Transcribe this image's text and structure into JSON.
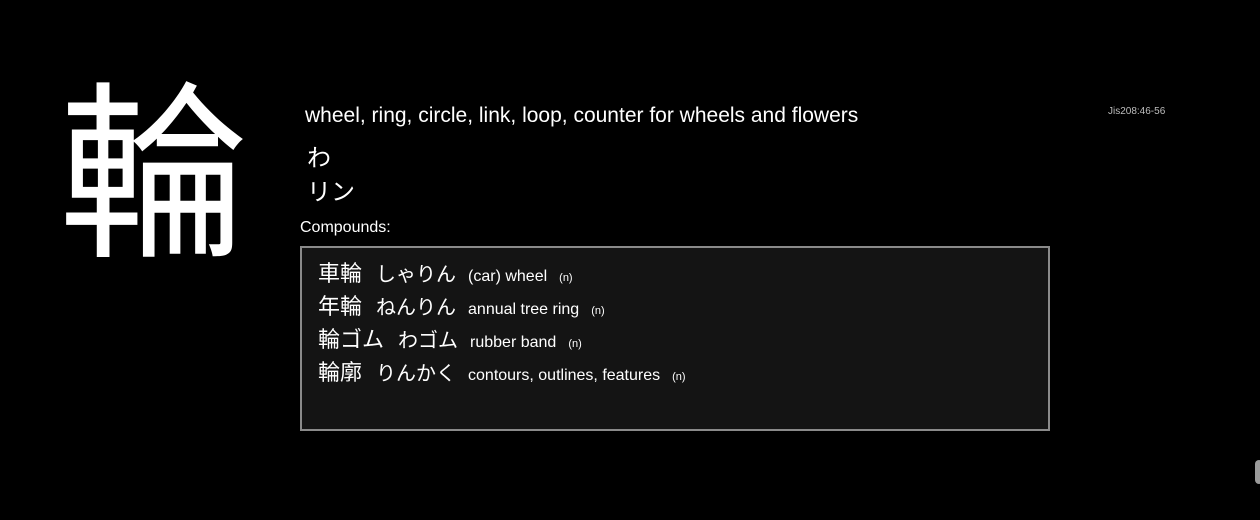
{
  "kanji": "輪",
  "meaning": "wheel, ring, circle, link, loop, counter for wheels and flowers",
  "readings": {
    "kun": "わ",
    "on": "リン"
  },
  "reference": "Jis208:46-56",
  "compounds_label": "Compounds:",
  "compounds": [
    {
      "word": "車輪",
      "reading": "しゃりん",
      "gloss": "(car) wheel",
      "pos": "(n)"
    },
    {
      "word": "年輪",
      "reading": "ねんりん",
      "gloss": "annual tree ring",
      "pos": "(n)"
    },
    {
      "word": "輪ゴム",
      "reading": "わゴム",
      "gloss": "rubber band",
      "pos": "(n)"
    },
    {
      "word": "輪廓",
      "reading": "りんかく",
      "gloss": "contours, outlines, features",
      "pos": "(n)"
    }
  ]
}
